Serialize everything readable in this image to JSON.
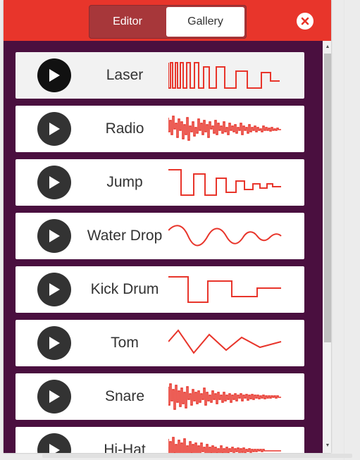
{
  "header": {
    "tabs": [
      {
        "label": "Editor",
        "active": false
      },
      {
        "label": "Gallery",
        "active": true
      }
    ],
    "close_icon": "close-icon",
    "accent_color": "#e8352b"
  },
  "panel_color": "#4a0f3f",
  "sounds": [
    {
      "name": "Laser",
      "selected": true
    },
    {
      "name": "Radio",
      "selected": false
    },
    {
      "name": "Jump",
      "selected": false
    },
    {
      "name": "Water Drop",
      "selected": false
    },
    {
      "name": "Kick Drum",
      "selected": false
    },
    {
      "name": "Tom",
      "selected": false
    },
    {
      "name": "Snare",
      "selected": false
    },
    {
      "name": "Hi-Hat",
      "selected": false
    }
  ],
  "wave_color": "#e8352b"
}
